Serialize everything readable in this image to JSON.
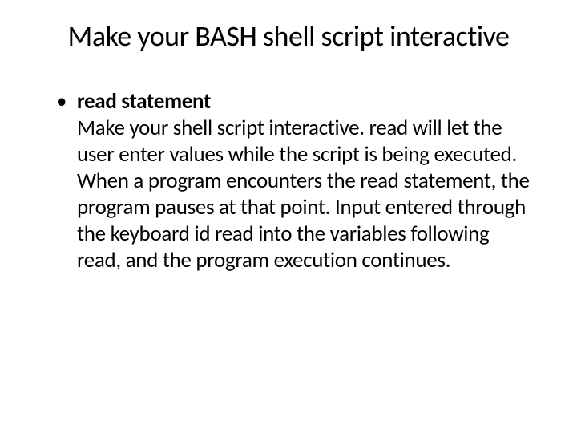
{
  "slide": {
    "title": "Make your BASH shell script interactive",
    "bullets": [
      {
        "heading": "read statement",
        "body": "Make your shell script interactive. read will let the user enter values while the script is being executed. When a program encounters the read statement, the program pauses at that point. Input entered through the keyboard id read into the variables following read, and the program execution continues."
      }
    ]
  }
}
